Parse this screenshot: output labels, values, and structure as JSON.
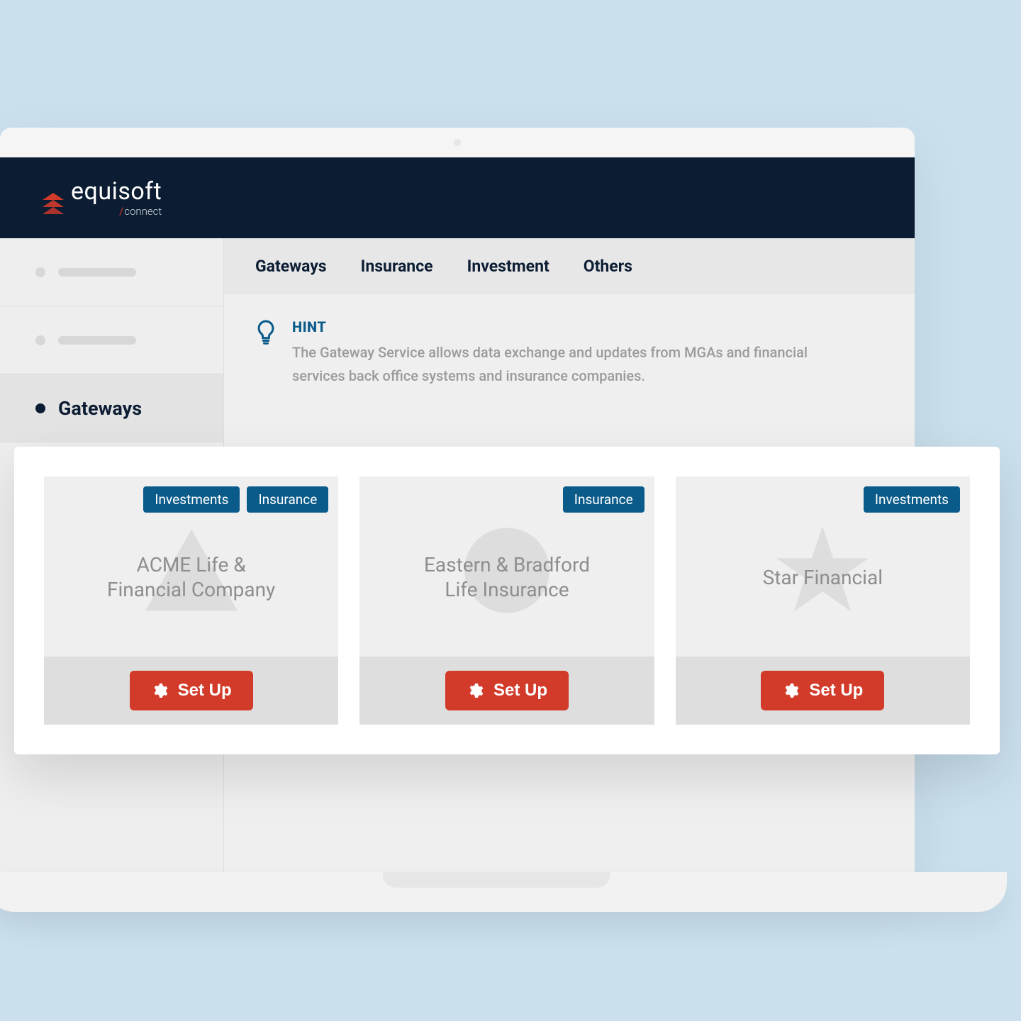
{
  "brand": {
    "name": "equisoft",
    "sub": "connect"
  },
  "sidebar": {
    "active_label": "Gateways"
  },
  "tabs": [
    "Gateways",
    "Insurance",
    "Investment",
    "Others"
  ],
  "hint": {
    "title": "HINT",
    "text": "The Gateway Service allows data exchange and updates from MGAs and financial services back office systems and insurance companies."
  },
  "cards": [
    {
      "tags": [
        "Investments",
        "Insurance"
      ],
      "title_line1": "ACME Life &",
      "title_line2": "Financial Company",
      "action": "Set Up",
      "shape": "triangle"
    },
    {
      "tags": [
        "Insurance"
      ],
      "title_line1": "Eastern & Bradford",
      "title_line2": "Life Insurance",
      "action": "Set Up",
      "shape": "circle"
    },
    {
      "tags": [
        "Investments"
      ],
      "title_line1": "Star Financial",
      "title_line2": "",
      "action": "Set Up",
      "shape": "star"
    }
  ],
  "colors": {
    "header": "#0c1d33",
    "accent_blue": "#0b5b8a",
    "accent_red": "#d23b2a"
  }
}
